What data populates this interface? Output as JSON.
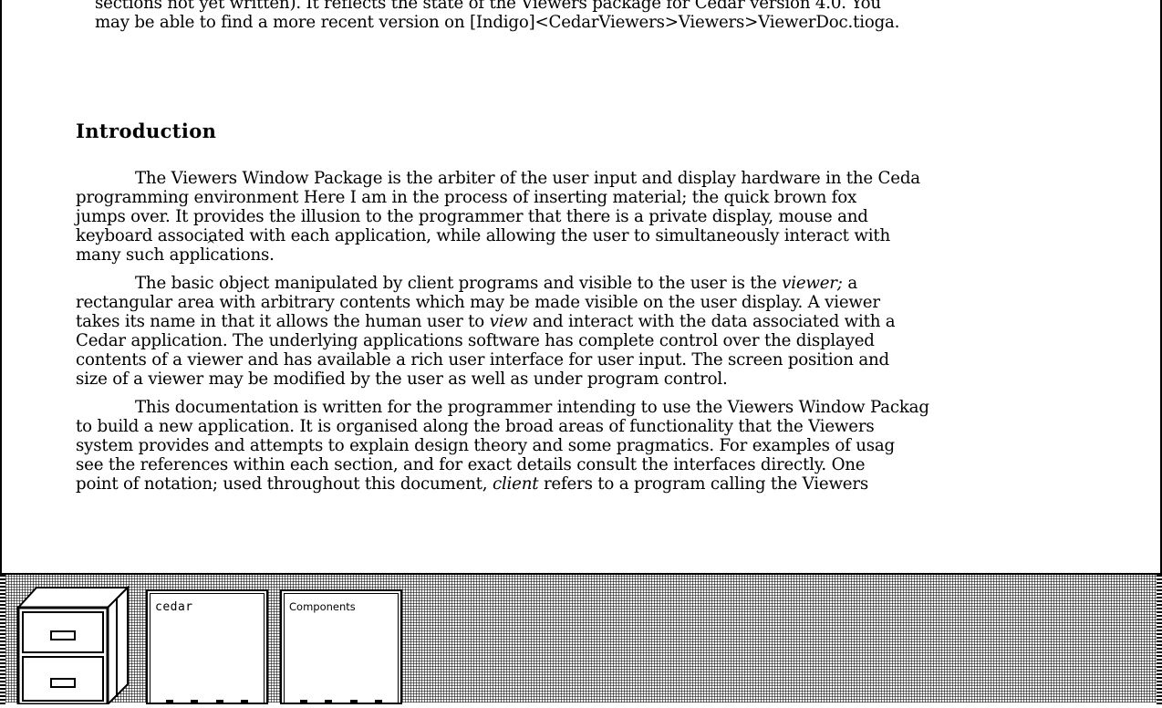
{
  "document": {
    "top_lines": [
      "sections not yet written). It reflects the state of the Viewers package for Cedar version 4.0.  You",
      "may be able to find a more recent version on [Indigo]<CedarViewers>Viewers>ViewerDoc.tioga."
    ],
    "heading": "Introduction",
    "para1": [
      "The Viewers Window Package is the arbiter of the user input and display hardware in the Ceda",
      "programming environment Here I am in the process of inserting material; the quick brown fox",
      "jumps over.  It provides the illusion to the programmer that there is a private display, mouse and",
      "keyboard associated with each application, while allowing the user to simultaneously interact with",
      "many such applications."
    ],
    "para2": {
      "l1a": "The basic object manipulated by client programs and visible to the user is the ",
      "l1em": "viewer;",
      "l1b": " a",
      "l2": "rectangular area with arbitrary contents which may be made visible on the user display.  A viewer",
      "l3a": "takes its name in that it allows the human user to ",
      "l3em": "view",
      "l3b": " and interact with the data associated with a",
      "l4": "Cedar application.  The underlying applications software has complete control over the displayed",
      "l5": "contents of a viewer and has available a rich user interface for user input.  The screen position and",
      "l6": "size of a viewer may be modified by the user as well as under program control."
    },
    "para3": {
      "l1": "This documentation is written for the programmer intending to use the Viewers Window Packag",
      "l2": "to build a new application.  It is organised along the broad areas of functionality that the Viewers",
      "l3": "system provides and attempts to explain design theory and some pragmatics.  For examples of usag",
      "l4": "see the references within each section, and for exact details consult the interfaces directly.  One",
      "l5a": "point of notation; used throughout this document, ",
      "l5em": "client",
      "l5b": " refers to a program calling the Viewers"
    }
  },
  "icons": [
    {
      "name": "file-cabinet",
      "label": ""
    },
    {
      "name": "cedar",
      "label": "cedar"
    },
    {
      "name": "components",
      "label": "Components"
    }
  ],
  "colors": {
    "foreground": "#000000",
    "background": "#ffffff"
  }
}
